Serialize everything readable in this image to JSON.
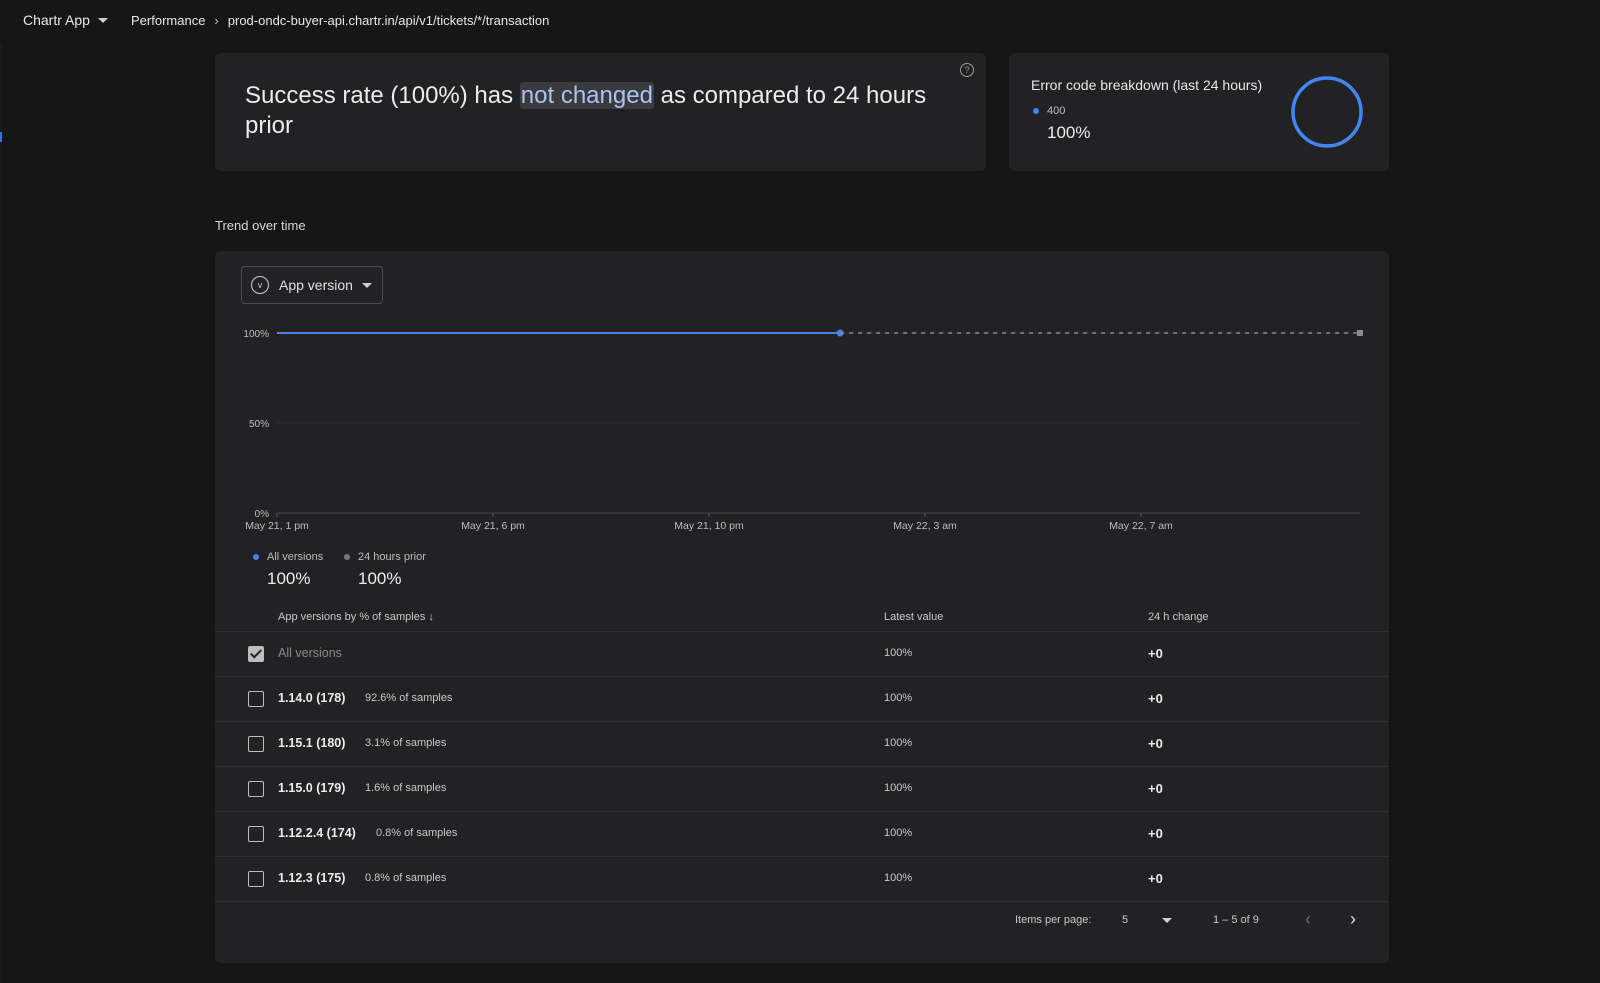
{
  "topbar": {
    "app_name": "Chartr App",
    "breadcrumb": [
      "Performance",
      "prod-ondc-buyer-api.chartr.in/api/v1/tickets/*/transaction"
    ]
  },
  "summary": {
    "pre": "Success rate (100%) has ",
    "highlight": "not changed",
    "post": " as compared to 24 hours prior",
    "help_icon": "help-circle-icon"
  },
  "errors": {
    "title": "Error code breakdown (last 24 hours)",
    "legend_code": "400",
    "legend_value": "100%",
    "color": "#4285f4"
  },
  "trend": {
    "section_label": "Trend over time",
    "version_button": "App version",
    "legend": [
      {
        "name": "All versions",
        "value": "100%",
        "color": "#4a7fe8"
      },
      {
        "name": "24 hours prior",
        "value": "100%",
        "color": "#7a7a7a"
      }
    ]
  },
  "chart_data": {
    "type": "line",
    "x_ticks": [
      "May 21, 1 pm",
      "May 21, 6 pm",
      "May 21, 10 pm",
      "May 22, 3 am",
      "May 22, 7 am"
    ],
    "y_ticks": [
      "100%",
      "50%",
      "0%"
    ],
    "ylim": [
      0,
      100
    ],
    "series": [
      {
        "name": "All versions",
        "style": "solid",
        "x": [
          0,
          0.52
        ],
        "values": [
          100,
          100
        ],
        "color": "#4a7fe8"
      },
      {
        "name": "24 hours prior",
        "style": "dashed",
        "x": [
          0.52,
          1
        ],
        "values": [
          100,
          100
        ],
        "color": "#8a8a8a"
      }
    ]
  },
  "table": {
    "headers": {
      "version": "App versions by % of samples",
      "latest": "Latest value",
      "change": "24 h change"
    },
    "rows": [
      {
        "name": "All versions",
        "samples": "",
        "latest": "100%",
        "change": "+0",
        "checked": true
      },
      {
        "name": "1.14.0 (178)",
        "samples": "92.6% of samples",
        "latest": "100%",
        "change": "+0",
        "checked": false
      },
      {
        "name": "1.15.1 (180)",
        "samples": "3.1% of samples",
        "latest": "100%",
        "change": "+0",
        "checked": false
      },
      {
        "name": "1.15.0 (179)",
        "samples": "1.6% of samples",
        "latest": "100%",
        "change": "+0",
        "checked": false
      },
      {
        "name": "1.12.2.4 (174)",
        "samples": "0.8% of samples",
        "latest": "100%",
        "change": "+0",
        "checked": false
      },
      {
        "name": "1.12.3 (175)",
        "samples": "0.8% of samples",
        "latest": "100%",
        "change": "+0",
        "checked": false
      }
    ]
  },
  "pager": {
    "items_per_page_label": "Items per page:",
    "items_per_page": "5",
    "range": "1 – 5 of 9"
  }
}
